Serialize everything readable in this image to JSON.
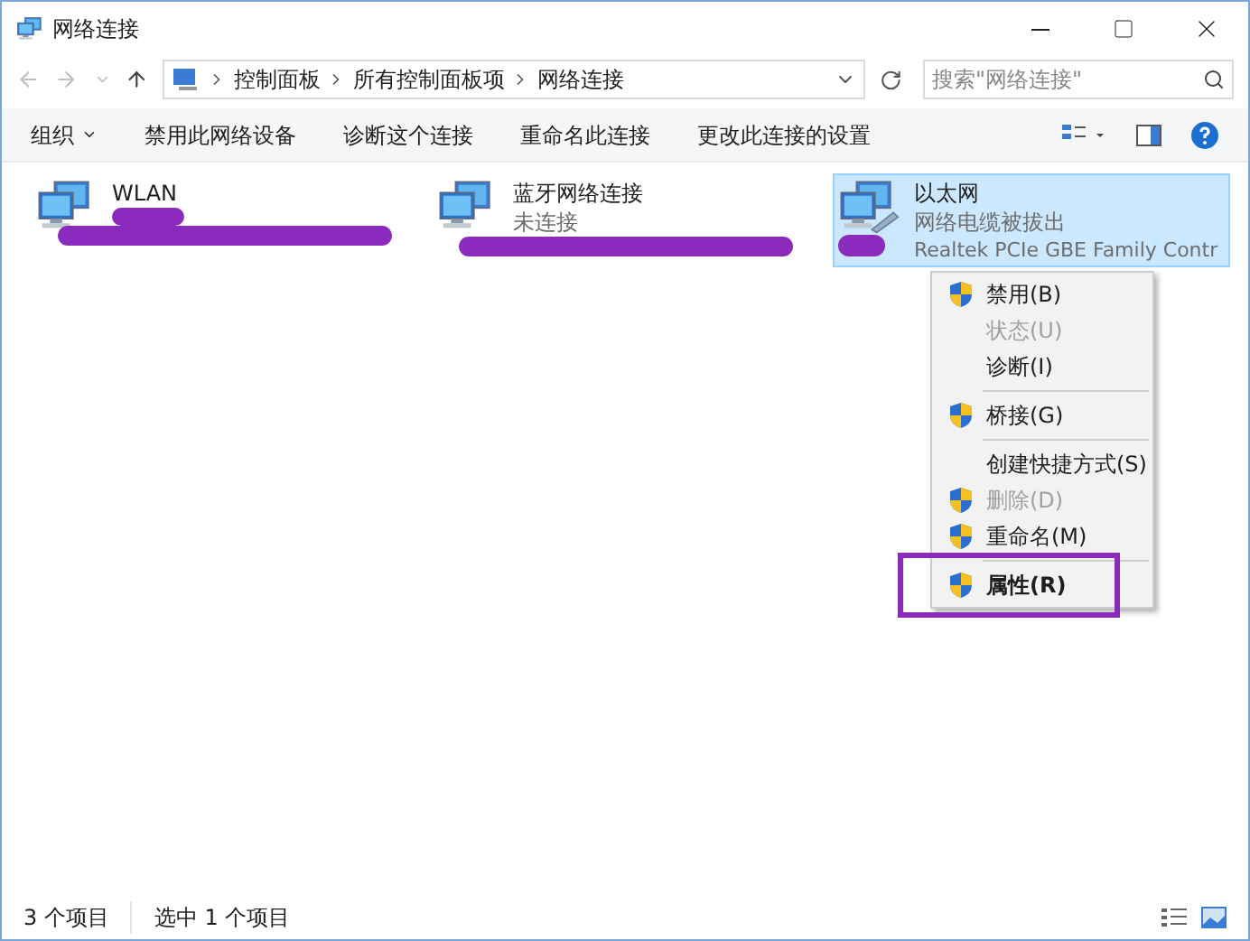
{
  "window": {
    "title": "网络连接"
  },
  "breadcrumbs": [
    "控制面板",
    "所有控制面板项",
    "网络连接"
  ],
  "search": {
    "placeholder": "搜索\"网络连接\""
  },
  "toolbar": [
    {
      "label": "组织",
      "dropdown": true
    },
    {
      "label": "禁用此网络设备",
      "dropdown": false
    },
    {
      "label": "诊断这个连接",
      "dropdown": false
    },
    {
      "label": "重命名此连接",
      "dropdown": false
    },
    {
      "label": "更改此连接的设置",
      "dropdown": false
    }
  ],
  "connections": [
    {
      "name": "WLAN",
      "selected": false,
      "cable": false
    },
    {
      "name": "蓝牙网络连接",
      "status": "未连接",
      "selected": false,
      "cable": false
    },
    {
      "name": "以太网",
      "status": "网络电缆被拔出",
      "device": "Realtek PCIe GBE Family Contr",
      "selected": true,
      "cable": true
    }
  ],
  "context_menu": [
    {
      "label": "禁用(B)",
      "shield": true,
      "disabled": false,
      "default": false,
      "separator_after": false
    },
    {
      "label": "状态(U)",
      "shield": false,
      "disabled": true,
      "default": false,
      "separator_after": false
    },
    {
      "label": "诊断(I)",
      "shield": false,
      "disabled": false,
      "default": false,
      "separator_after": true
    },
    {
      "label": "桥接(G)",
      "shield": true,
      "disabled": false,
      "default": false,
      "separator_after": true
    },
    {
      "label": "创建快捷方式(S)",
      "shield": false,
      "disabled": false,
      "default": false,
      "separator_after": false
    },
    {
      "label": "删除(D)",
      "shield": true,
      "disabled": true,
      "default": false,
      "separator_after": false
    },
    {
      "label": "重命名(M)",
      "shield": true,
      "disabled": false,
      "default": false,
      "separator_after": true
    },
    {
      "label": "属性(R)",
      "shield": true,
      "disabled": false,
      "default": true,
      "separator_after": false
    }
  ],
  "status_bar": [
    "3 个项目",
    "选中 1 个项目"
  ]
}
